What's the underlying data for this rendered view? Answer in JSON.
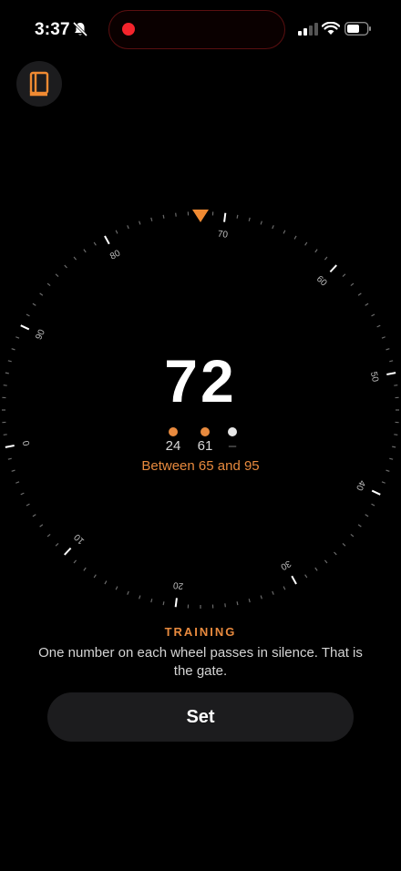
{
  "status_bar": {
    "time": "3:37"
  },
  "dial": {
    "ticks": [
      "0",
      "10",
      "20",
      "30",
      "40",
      "50",
      "60",
      "70",
      "80",
      "90"
    ],
    "current_value": "72",
    "wheel_values": [
      "24",
      "61",
      "–"
    ],
    "wheel_dot_colors": [
      "#e88a3e",
      "#e88a3e",
      "#e6e6e6"
    ],
    "range_text": "Between 65 and 95",
    "pointer_color": "#f08a32"
  },
  "mode_label": "TRAINING",
  "hint_text": "One number on each wheel passes in silence. That is the gate.",
  "set_button_label": "Set",
  "colors": {
    "accent": "#e88a3e",
    "record": "#f5242c",
    "button_bg": "#1c1c1e"
  }
}
